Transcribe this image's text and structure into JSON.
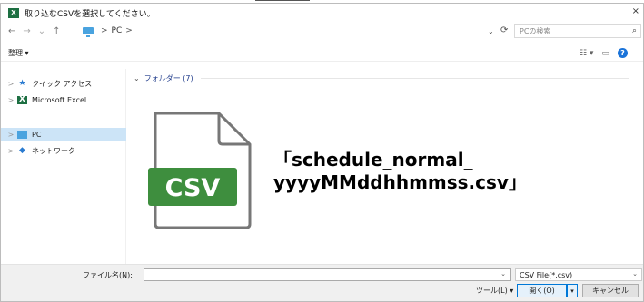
{
  "window": {
    "title": "取り込むCSVを選択してください。",
    "close_glyph": "×"
  },
  "nav": {
    "back": "←",
    "forward": "→",
    "recent": "⌄",
    "up": "↑",
    "path": [
      "PC"
    ],
    "separator": ">",
    "refresh": "⟳",
    "dropdown": "⌄",
    "search_placeholder": "PCの検索"
  },
  "toolbar": {
    "organize_label": "整理 ▾"
  },
  "sidebar": {
    "items": [
      {
        "label": "クイック アクセス",
        "icon": "star-icon",
        "selected": false
      },
      {
        "label": "Microsoft Excel",
        "icon": "excel-icon",
        "selected": false
      },
      {
        "label": "PC",
        "icon": "pc-icon",
        "selected": true
      },
      {
        "label": "ネットワーク",
        "icon": "network-icon",
        "selected": false
      }
    ],
    "chevron": ">"
  },
  "content": {
    "group_header": "フォルダー (7)",
    "file_badge": "CSV",
    "file_caption": "「schedule_normal_\nyyyyMMddhhmmss.csv」"
  },
  "bottom": {
    "filename_label": "ファイル名(N):",
    "filename_value": "",
    "filetype_selected": "CSV File(*.csv)",
    "tools_label": "ツール(L)  ▾",
    "open_label": "開く(O)",
    "cancel_label": "キャンセル"
  },
  "colors": {
    "accent_blue": "#0078d7",
    "csv_green": "#3e8e3e",
    "selection": "#cce4f7"
  }
}
